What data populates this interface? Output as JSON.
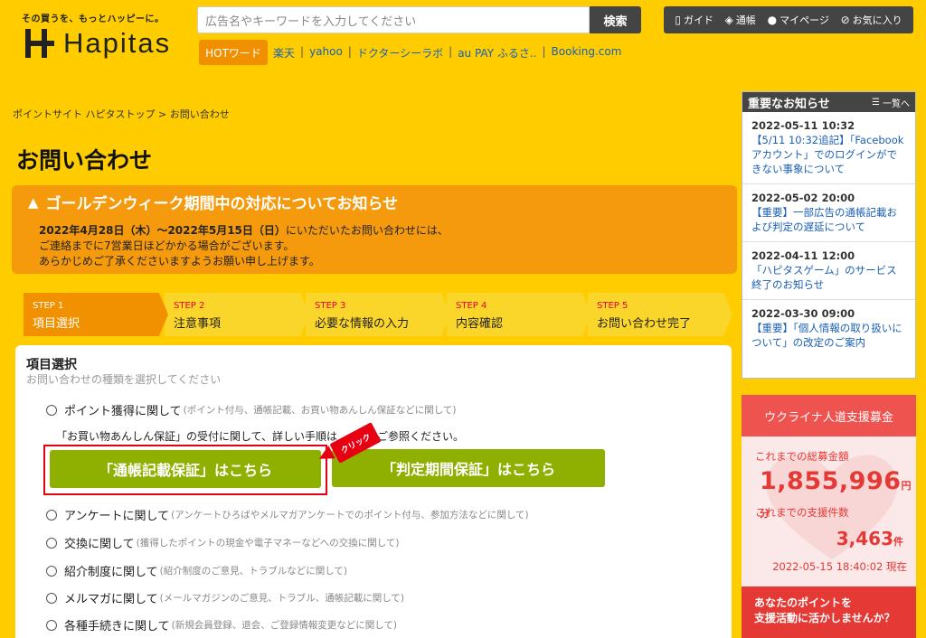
{
  "header": {
    "tagline": "その買うを、もっとハッピーに。",
    "logo_text": "Hapitas",
    "search_placeholder": "広告名やキーワードを入力してください",
    "search_button": "検索",
    "user_nav": [
      {
        "label": "ガイド",
        "icon": "guide-icon"
      },
      {
        "label": "通帳",
        "icon": "passbook-icon"
      },
      {
        "label": "マイページ",
        "icon": "person-icon"
      },
      {
        "label": "お気に入り",
        "icon": "clip-icon"
      }
    ],
    "hot_label": "HOTワード",
    "hot_links": [
      "楽天",
      "yahoo",
      "ドクターシーラボ",
      "au PAY ふるさ..",
      "Booking.com"
    ]
  },
  "breadcrumb": {
    "items": [
      "ポイントサイト ハピタストップ",
      "お問い合わせ"
    ],
    "separator": ">"
  },
  "page_title": "お問い合わせ",
  "notice": {
    "title": "ゴールデンウィーク期間中の対応についてお知らせ",
    "period": "2022年4月28日（木）〜2022年5月15日（日）",
    "line1_rest": "にいただいたお問い合わせには、",
    "line2": "ご連絡までに7営業日ほどかかる場合がございます。",
    "line3": "あらかじめご了承くださいますようお願い申し上げます。"
  },
  "steps": [
    {
      "num": "STEP 1",
      "label": "項目選択",
      "active": true
    },
    {
      "num": "STEP 2",
      "label": "注意事項",
      "active": false
    },
    {
      "num": "STEP 3",
      "label": "必要な情報の入力",
      "active": false
    },
    {
      "num": "STEP 4",
      "label": "内容確認",
      "active": false
    },
    {
      "num": "STEP 5",
      "label": "お問い合わせ完了",
      "active": false
    }
  ],
  "main": {
    "section_title": "項目選択",
    "section_sub": "お問い合わせの種類を選択してください",
    "options": [
      {
        "label": "ポイント獲得に関して",
        "note": "(ポイント付与、通帳記載、お買い物あんしん保証などに関して)"
      },
      {
        "label": "アンケートに関して",
        "note": "(アンケートひろばやメルマガアンケートでのポイント付与、参加方法などに関して)"
      },
      {
        "label": "交換に関して",
        "note": "(獲得したポイントの現金や電子マネーなどへの交換に関して)"
      },
      {
        "label": "紹介制度に関して",
        "note": "(紹介制度のご意見、トラブルなどに関して)"
      },
      {
        "label": "メルマガに関して",
        "note": "(メールマガジンのご意見、トラブル、通帳記載に関して)"
      },
      {
        "label": "各種手続きに関して",
        "note": "(新規会員登録、退会、ご登録情報変更などに関して)"
      }
    ],
    "guide_text": "「お買い物あんしん保証」の受付に関して、詳しい手順は",
    "guide_text_end": "ご参照ください。",
    "btn_passbook": "「通帳記載保証」はこちら",
    "btn_period": "「判定期間保証」はこちら",
    "click_label": "クリック"
  },
  "news": {
    "title": "重要なお知らせ",
    "all_label": "一覧へ",
    "items": [
      {
        "date": "2022-05-11 10:32",
        "text": "【5/11 10:32追記】「Facebookアカウント」でのログインができない事象について"
      },
      {
        "date": "2022-05-02 20:00",
        "text": "【重要】一部広告の通帳記載および判定の遅延について"
      },
      {
        "date": "2022-04-11 12:00",
        "text": "「ハピタスゲーム」のサービス終了のお知らせ"
      },
      {
        "date": "2022-03-30 09:00",
        "text": "【重要】「個人情報の取り扱いについて」の改定のご案内"
      }
    ]
  },
  "donation": {
    "title": "ウクライナ人道支援募金",
    "total_label": "これまでの総募金額",
    "total_amount": "1,855,996",
    "total_unit": "円分",
    "count_label": "これまでの支援件数",
    "count": "3,463",
    "count_unit": "件",
    "as_of": "2022-05-15 18:40:02 現在",
    "cta_line1": "あなたのポイントを",
    "cta_line2": "支援活動に活かしませんか？"
  },
  "colors": {
    "background": "#ffcc00",
    "notice": "#f59a0c",
    "step_active": "#f29100",
    "button_green": "#8fb000",
    "highlight_red": "#e60012",
    "donation_red": "#e53935"
  }
}
